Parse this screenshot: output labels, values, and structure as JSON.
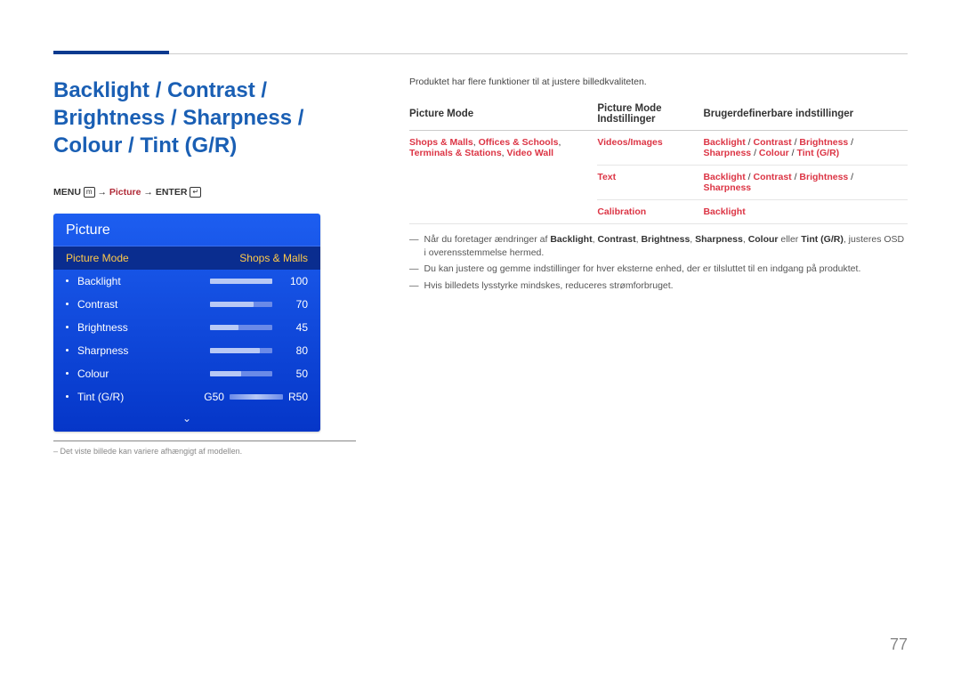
{
  "title": "Backlight / Contrast / Brightness / Sharpness / Colour / Tint (G/R)",
  "menupath": {
    "menu": "MENU",
    "arrow": "→",
    "picture": "Picture",
    "enter": "ENTER"
  },
  "osd": {
    "header": "Picture",
    "mode_label": "Picture Mode",
    "mode_value": "Shops & Malls",
    "items": [
      {
        "label": "Backlight",
        "value": "100",
        "pct": 100
      },
      {
        "label": "Contrast",
        "value": "70",
        "pct": 70
      },
      {
        "label": "Brightness",
        "value": "45",
        "pct": 45
      },
      {
        "label": "Sharpness",
        "value": "80",
        "pct": 80
      },
      {
        "label": "Colour",
        "value": "50",
        "pct": 50
      }
    ],
    "tint_label": "Tint (G/R)",
    "tint_g": "G50",
    "tint_r": "R50",
    "chevron": "⌄"
  },
  "footnote_left": "Det viste billede kan variere afhængigt af modellen.",
  "right": {
    "intro": "Produktet har flere funktioner til at justere billedkvaliteten.",
    "th1": "Picture Mode",
    "th2": "Picture Mode Indstillinger",
    "th3": "Brugerdefinerbare indstillinger",
    "rows": [
      {
        "c1": "Shops & Malls, Offices & Schools, Terminals & Stations, Video Wall",
        "c2": "Videos/Images",
        "c3": "Backlight / Contrast / Brightness / Sharpness / Colour / Tint (G/R)"
      },
      {
        "c1": "",
        "c2": "Text",
        "c3": "Backlight / Contrast / Brightness / Sharpness"
      },
      {
        "c1": "",
        "c2": "Calibration",
        "c3": "Backlight"
      }
    ],
    "notes": [
      "Når du foretager ændringer af Backlight, Contrast, Brightness, Sharpness, Colour eller Tint (G/R), justeres OSD i overensstemmelse hermed.",
      "Du kan justere og gemme indstillinger for hver eksterne enhed, der er tilsluttet til en indgang på produktet.",
      "Hvis billedets lysstyrke mindskes, reduceres strømforbruget."
    ]
  },
  "pagenum": "77"
}
